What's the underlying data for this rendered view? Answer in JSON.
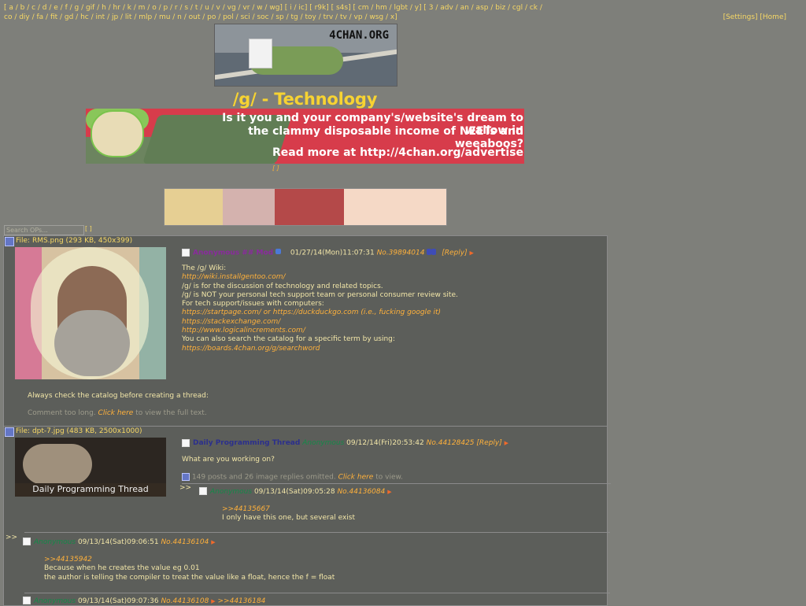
{
  "nav": {
    "boards_line1": "[ a / b / c / d / e / f / g / gif / h / hr / k / m / o / p / r / s / t / u / v / vg / vr / w / wg] [ i / ic] [ r9k] [ s4s] [ cm / hm / lgbt / y] [ 3 / adv / an / asp / biz / cgl / ck /",
    "boards_line2": "co / diy / fa / fit / gd / hc / int / jp / lit / mlp / mu / n / out / po / pol / sci / soc / sp / tg / toy / trv / tv / vp / wsg / x]",
    "settings": "[Settings]",
    "home": "[Home]"
  },
  "logo_text": "4CHAN.ORG",
  "board_title": "/g/ - Technology",
  "ad": {
    "line1": "Is it you and your company's/website's dream to wallow in",
    "line2": "the clammy disposable income of NEETs and weeaboos?",
    "line3": "Read more at http://4chan.org/advertise"
  },
  "small_link": "[ ]",
  "start_thread": "",
  "ad2_text": "",
  "search": {
    "placeholder": "Search OPs...",
    "button": "[ ]"
  },
  "threads": [
    {
      "file_label": "File: RMS.png (293 KB, 450x399)",
      "poster": "Anonymous ## Mod",
      "datetime": "01/27/14(Mon)11:07:31",
      "number": "No.39894014",
      "reply": "[Reply]",
      "body": [
        "The /g/ Wiki:",
        "http://wiki.installgentoo.com/",
        "",
        "/g/ is for the discussion of technology and related topics.",
        "/g/ is NOT your personal tech support team or personal consumer review site.",
        "",
        "For tech support/issues with computers:",
        "https://startpage.com/ or https://duckduckgo.com (i.e., fucking google it)",
        "https://stackexchange.com/",
        "http://www.logicalincrements.com/",
        "",
        "You can also search the catalog for a specific term by using:",
        "https://boards.4chan.org/g/searchword"
      ],
      "bottom_note": "Always check the catalog before creating a thread:",
      "long_comment": "Comment too long.",
      "click_here": "Click here",
      "view_full": "to view the full text."
    },
    {
      "file_label": "File: dpt-7.jpg (483 KB, 2500x1000)",
      "subject": "Daily Programming Thread",
      "poster": "Anonymous",
      "datetime": "09/12/14(Fri)20:53:42",
      "number": "No.44128425",
      "reply": "[Reply]",
      "body": "What are you working on?",
      "omitted": "149 posts and 26 image replies omitted.",
      "click_here": "Click here",
      "view": "to view."
    }
  ],
  "replies": [
    {
      "poster": "Anonymous",
      "datetime": "09/13/14(Sat)09:05:28",
      "number": "No.44136084",
      "quote": ">>44135667",
      "text": "I only have this one, but several exist"
    },
    {
      "poster": "Anonymous",
      "datetime": "09/13/14(Sat)09:06:51",
      "number": "No.44136104",
      "quote": ">>44135942",
      "text1": "Because when he creates the value eg 0.01",
      "text2": "the author is telling the compiler to treat the value like a float, hence the f = float"
    },
    {
      "poster": "Anonymous",
      "datetime": "09/13/14(Sat)09:07:36",
      "number": "No.44136108",
      "quote": ">>44136184"
    }
  ],
  "thumbnail2_caption": "Daily Programming Thread",
  "post_marker": ">>"
}
